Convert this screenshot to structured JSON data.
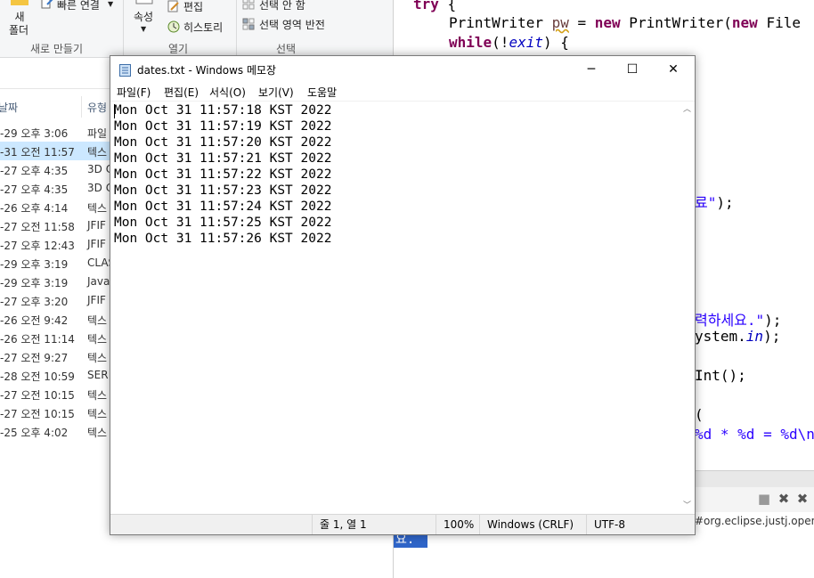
{
  "explorer": {
    "ribbon": {
      "new_folder_line1": "새",
      "new_folder_line2": "폴더",
      "quick_access_label": "빠른 연결",
      "properties_label": "속성",
      "edit_label": "편집",
      "history_label": "히스토리",
      "select_none_label": "선택 안 함",
      "invert_selection_label": "선택 영역 반전",
      "group_new": "새로 만들기",
      "group_open": "열기",
      "group_select": "선택"
    },
    "columns": {
      "date": "날짜",
      "type": "유형"
    },
    "rows": [
      {
        "date": "-29 오후 3:06",
        "type": "파일"
      },
      {
        "date": "-31 오전 11:57",
        "type": "텍스"
      },
      {
        "date": "-27 오후 4:35",
        "type": "3D C"
      },
      {
        "date": "-27 오후 4:35",
        "type": "3D C"
      },
      {
        "date": "-26 오후 4:14",
        "type": "텍스"
      },
      {
        "date": "-27 오전 11:58",
        "type": "JFIF"
      },
      {
        "date": "-27 오후 12:43",
        "type": "JFIF"
      },
      {
        "date": "-29 오후 3:19",
        "type": "CLAS"
      },
      {
        "date": "-29 오후 3:19",
        "type": "Java"
      },
      {
        "date": "-27 오후 3:20",
        "type": "JFIF"
      },
      {
        "date": "-26 오전 9:42",
        "type": "텍스"
      },
      {
        "date": "-26 오전 11:14",
        "type": "텍스"
      },
      {
        "date": "-27 오전 9:27",
        "type": "텍스"
      },
      {
        "date": "-28 오전 10:59",
        "type": "SER"
      },
      {
        "date": "-27 오전 10:15",
        "type": "텍스"
      },
      {
        "date": "-27 오전 10:15",
        "type": "텍스"
      },
      {
        "date": "-25 오후 4:02",
        "type": "텍스"
      }
    ]
  },
  "eclipse": {
    "code": {
      "l1_kw": "try",
      "l1_rest": " {",
      "l2_a": "PrintWriter ",
      "l2_var": "pw",
      "l2_b": " = ",
      "l2_kw1": "new",
      "l2_c": " PrintWriter(",
      "l2_kw2": "new",
      "l2_d": " File",
      "l3_kw": "while",
      "l3_a": "(!",
      "l3_field": "exit",
      "l3_b": ") {",
      "l4_str": "료\"",
      "l4_rest": ");",
      "l5_str": "력하세요.\"",
      "l5_rest": ");",
      "l6_a": "ystem.",
      "l6_field": "in",
      "l6_rest": ");",
      "l7": "Int();",
      "l8": "(",
      "l9_str": "%d * %d = %d\\n"
    },
    "console_text": "#org.eclipse.justj.openjdk",
    "console_highlight": "요."
  },
  "notepad": {
    "title": "dates.txt - Windows 메모장",
    "menu": [
      "파일(F)",
      "편집(E)",
      "서식(O)",
      "보기(V)",
      "도움말"
    ],
    "lines": [
      "Mon Oct 31 11:57:18 KST 2022",
      "Mon Oct 31 11:57:19 KST 2022",
      "Mon Oct 31 11:57:20 KST 2022",
      "Mon Oct 31 11:57:21 KST 2022",
      "Mon Oct 31 11:57:22 KST 2022",
      "Mon Oct 31 11:57:23 KST 2022",
      "Mon Oct 31 11:57:24 KST 2022",
      "Mon Oct 31 11:57:25 KST 2022",
      "Mon Oct 31 11:57:26 KST 2022"
    ],
    "status": {
      "position": "줄 1, 열 1",
      "zoom": "100%",
      "line_ending": "Windows (CRLF)",
      "encoding": "UTF-8"
    },
    "buttons": {
      "minimize": "─",
      "maximize": "☐",
      "close": "✕"
    }
  }
}
